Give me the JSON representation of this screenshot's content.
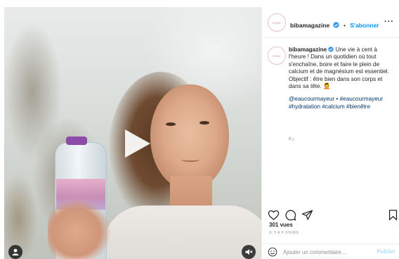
{
  "post": {
    "account": {
      "username": "bibamagazine",
      "avatar_text": "BIBA",
      "verified": true
    },
    "header": {
      "separator": "•",
      "follow_label": "S'abonner",
      "more_label": "···"
    },
    "caption": {
      "username": "bibamagazine",
      "text_lines": [
        "Une vie à cent à l'heure ! Dans un quotidien où tout s'enchaîne, boire et faire le plein de calcium et de magnésium est essentiel.",
        "Objectif : être bien dans son corps et dans sa tête. 💆"
      ],
      "hashtags": "@eaucourmayeur • #eaucourmayeur #hydratation #calcium #bienêtre",
      "time_ago": "6 j"
    },
    "stats": {
      "views": "301 vues",
      "date": "IL Y A 6 JOURS"
    },
    "comment": {
      "placeholder": "Ajouter un commentaire...",
      "publish_label": "Publier"
    }
  },
  "media": {
    "type": "video",
    "icons": [
      "play-icon",
      "user-tag-icon",
      "mute-icon"
    ]
  },
  "colors": {
    "link_blue": "#0095f6",
    "hashtag_blue": "#00376b",
    "verified_blue": "#3897f0",
    "muted_gray": "#8e8e8e",
    "publish_disabled": "#b2dffc"
  }
}
